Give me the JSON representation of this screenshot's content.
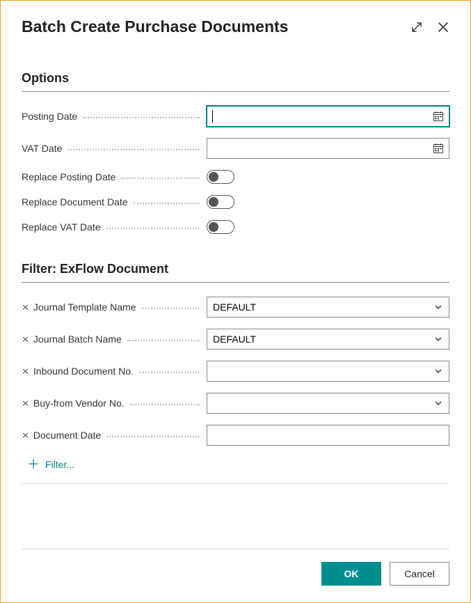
{
  "header": {
    "title": "Batch Create Purchase Documents"
  },
  "sections": {
    "options": {
      "title": "Options"
    },
    "filter": {
      "title": "Filter: ExFlow Document"
    }
  },
  "options": {
    "posting_date_label": "Posting Date",
    "posting_date_value": "",
    "vat_date_label": "VAT Date",
    "vat_date_value": "",
    "replace_posting_date_label": "Replace Posting Date",
    "replace_posting_date_on": false,
    "replace_document_date_label": "Replace Document Date",
    "replace_document_date_on": false,
    "replace_vat_date_label": "Replace VAT Date",
    "replace_vat_date_on": false
  },
  "filter": {
    "journal_template_name_label": "Journal Template Name",
    "journal_template_name_value": "DEFAULT",
    "journal_batch_name_label": "Journal Batch Name",
    "journal_batch_name_value": "DEFAULT",
    "inbound_document_no_label": "Inbound Document No.",
    "inbound_document_no_value": "",
    "buy_from_vendor_no_label": "Buy-from Vendor No.",
    "buy_from_vendor_no_value": "",
    "document_date_label": "Document Date",
    "document_date_value": ""
  },
  "filter_link": "Filter...",
  "footer": {
    "ok": "OK",
    "cancel": "Cancel"
  }
}
